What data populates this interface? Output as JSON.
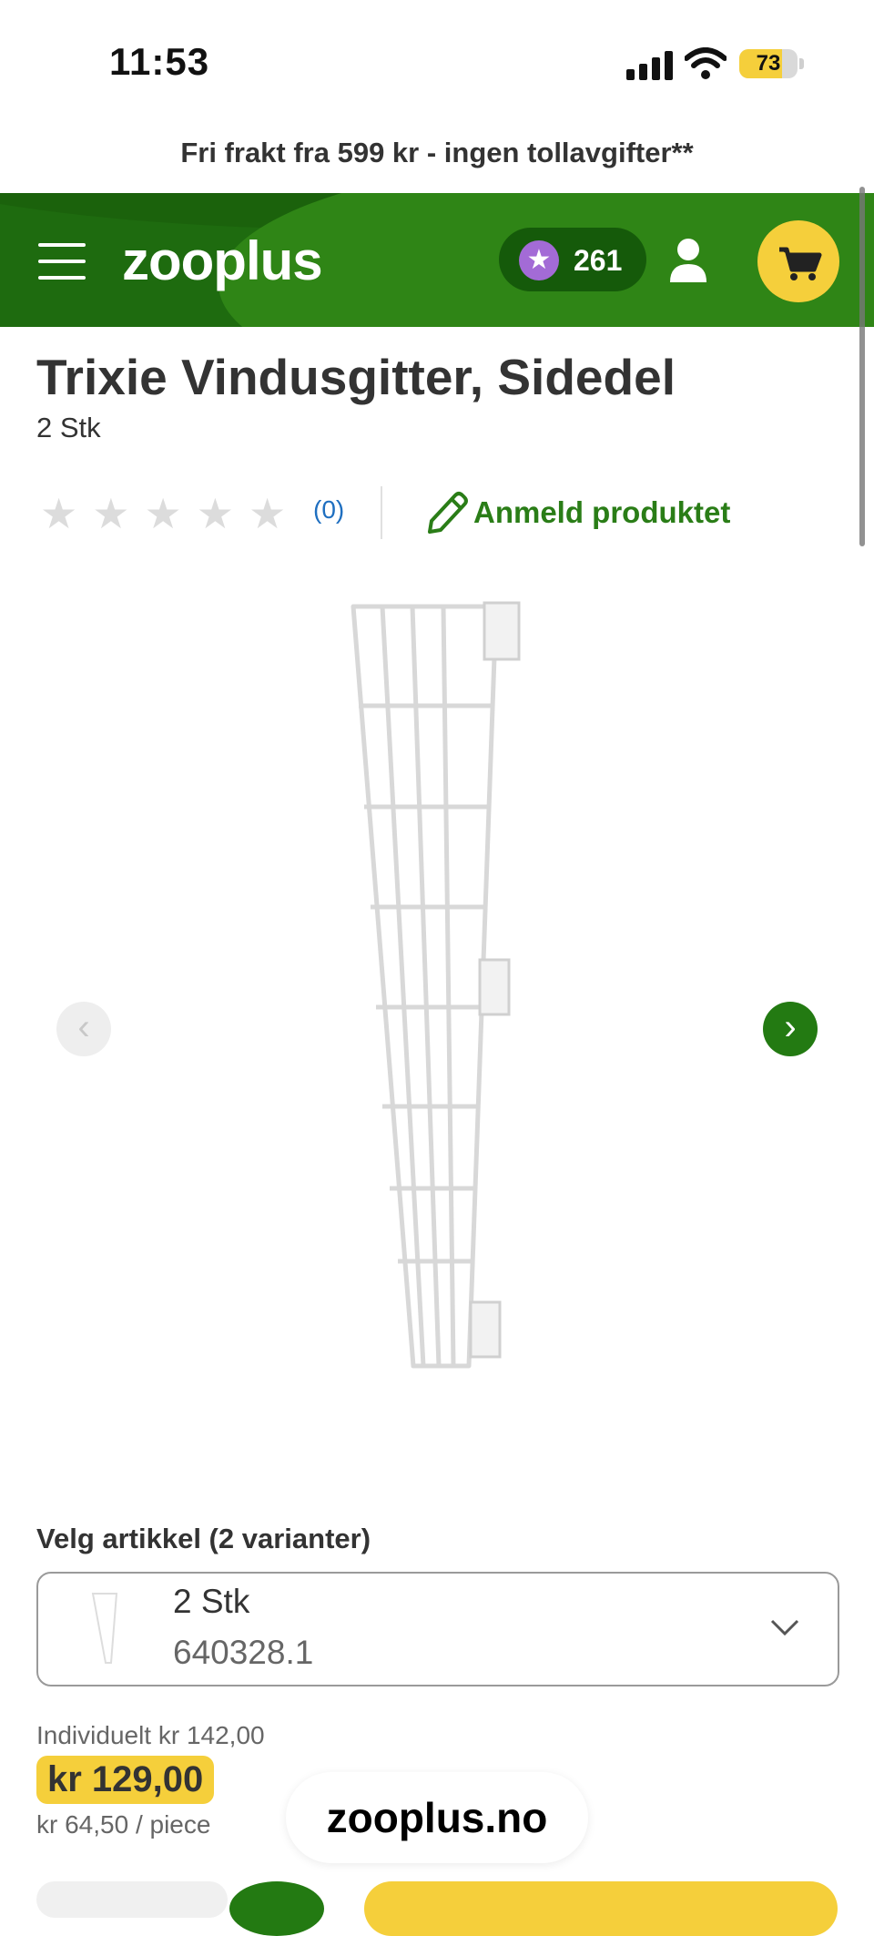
{
  "status_bar": {
    "time": "11:53",
    "battery_level": "73"
  },
  "promo_bar": {
    "text": "Fri frakt fra 599 kr - ingen tollavgifter**"
  },
  "header": {
    "logo": "zooplus",
    "points": "261",
    "brand_colors": {
      "green": "#1e6b0f",
      "yellow": "#f5cf3b"
    }
  },
  "product": {
    "title": "Trixie Vindusgitter, Sidedel",
    "subtitle": "2 Stk",
    "rating": {
      "stars": 0,
      "max_stars": 5,
      "count_label": "(0)"
    },
    "review_link": "Anmeld produktet"
  },
  "variant_selector": {
    "label": "Velg artikkel (2 varianter)",
    "selected_name": "2 Stk",
    "selected_sku": "640328.1"
  },
  "pricing": {
    "individual": "Individuelt kr 142,00",
    "price": "kr 129,00",
    "unit_price": "kr 64,50 / piece"
  },
  "browser": {
    "domain": "zooplus.no"
  }
}
